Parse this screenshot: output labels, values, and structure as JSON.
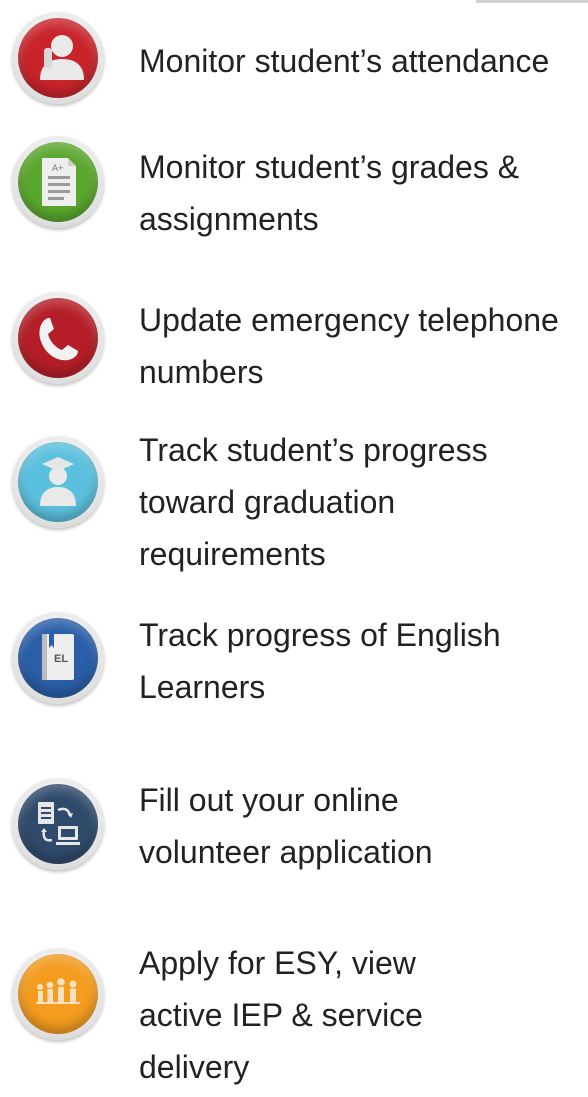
{
  "features": [
    {
      "id": "attendance",
      "lines": [
        "Monitor student’s attendance"
      ],
      "icon": "student-silhouette-icon",
      "color": "#c9242b"
    },
    {
      "id": "grades",
      "lines": [
        "Monitor student’s grades &",
        "assignments"
      ],
      "icon": "graded-paper-icon",
      "color": "#5aa72e"
    },
    {
      "id": "emergency",
      "lines": [
        "Update emergency telephone",
        "numbers"
      ],
      "icon": "telephone-handset-icon",
      "color": "#b51e28"
    },
    {
      "id": "graduation",
      "lines": [
        "Track student’s progress",
        "toward graduation",
        "requirements"
      ],
      "icon": "graduate-icon",
      "color": "#5bc0de"
    },
    {
      "id": "english-learners",
      "lines": [
        "Track progress of English",
        "Learners"
      ],
      "icon": "el-book-icon",
      "color": "#2a5ea8"
    },
    {
      "id": "volunteer",
      "lines": [
        "Fill out your online",
        "volunteer application"
      ],
      "icon": "document-computer-icon",
      "color": "#2f4a6b"
    },
    {
      "id": "esy",
      "lines": [
        "Apply for ESY, view",
        "active IEP & service",
        "delivery"
      ],
      "icon": "group-of-people-icon",
      "color": "#f39c1f"
    }
  ],
  "icon_glyph_text": {
    "grades": "A+",
    "english_learners": "EL"
  }
}
